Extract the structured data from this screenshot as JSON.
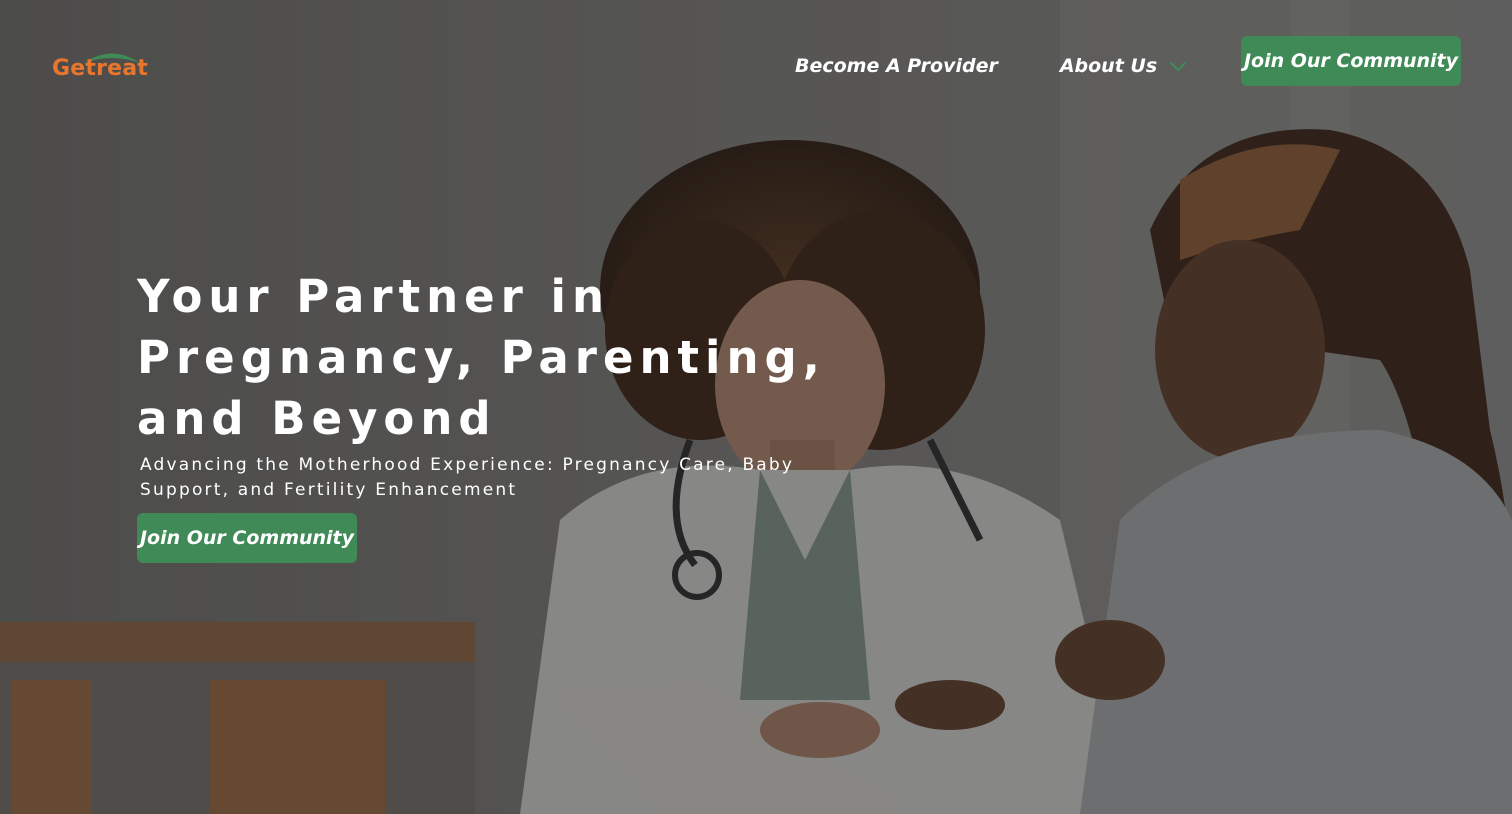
{
  "brand": {
    "logo_text": "Getreat",
    "logo_color": "#e8762c",
    "logo_arc_color": "#3f8a57"
  },
  "nav": {
    "items": [
      {
        "label": "Become A Provider"
      },
      {
        "label": "About Us",
        "icon": "chevron-down-icon"
      }
    ],
    "cta_label": "Join Our Community"
  },
  "hero": {
    "headline": "Your Partner in Pregnancy, Parenting, and Beyond",
    "subheadline": "Advancing the Motherhood Experience: Pregnancy Care, Baby Support, and Fertility Enhancement",
    "cta_label": "Join Our Community",
    "image_description": "doctor with stethoscope reviewing clipboard with a patient"
  },
  "colors": {
    "accent_green": "#3f8a57",
    "text_on_dark": "#ffffff"
  }
}
